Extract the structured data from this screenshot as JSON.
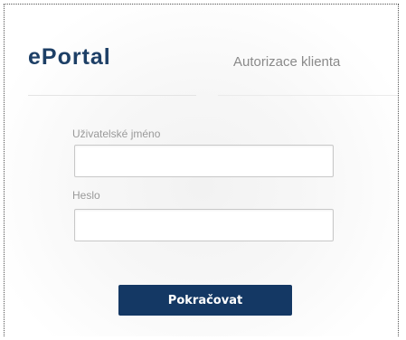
{
  "header": {
    "logo": "ePortal",
    "title": "Autorizace klienta"
  },
  "form": {
    "username_label": "Uživatelské jméno",
    "username_value": "",
    "password_label": "Heslo",
    "password_value": "",
    "submit_label": "Pokračovat"
  },
  "colors": {
    "brand": "#1d3f66",
    "button": "#143864"
  }
}
